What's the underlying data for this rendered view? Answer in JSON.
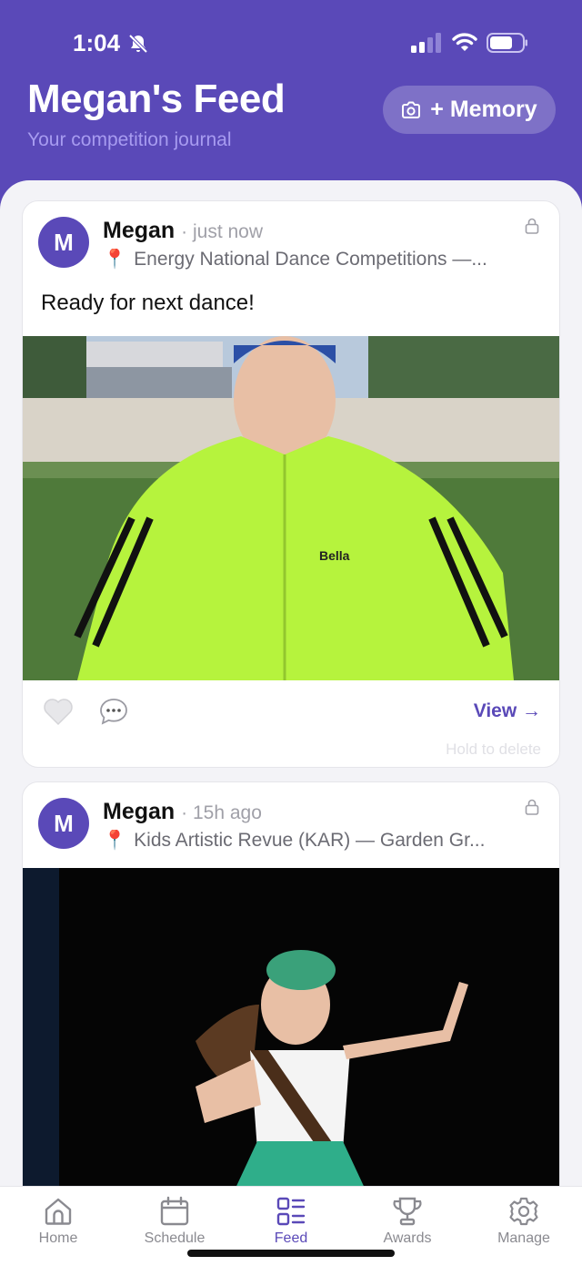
{
  "status": {
    "time": "1:04"
  },
  "header": {
    "title": "Megan's Feed",
    "subtitle": "Your competition journal",
    "memory_button": "+ Memory"
  },
  "posts": [
    {
      "avatar": "M",
      "author": "Megan",
      "time": "· just now",
      "location": "Energy National Dance Competitions —...",
      "text": "Ready for next dance!",
      "photo_text": "Bella",
      "view_label": "View →",
      "hold_hint": "Hold to delete"
    },
    {
      "avatar": "M",
      "author": "Megan",
      "time": "· 15h ago",
      "location": "Kids Artistic Revue (KAR) — Garden Gr..."
    }
  ],
  "tabs": [
    {
      "label": "Home",
      "icon": "home-icon"
    },
    {
      "label": "Schedule",
      "icon": "calendar-icon"
    },
    {
      "label": "Feed",
      "icon": "feed-icon",
      "active": true
    },
    {
      "label": "Awards",
      "icon": "trophy-icon"
    },
    {
      "label": "Manage",
      "icon": "gear-icon"
    }
  ],
  "colors": {
    "brand": "#5a49b8",
    "accent_green": "#b6f33d"
  }
}
